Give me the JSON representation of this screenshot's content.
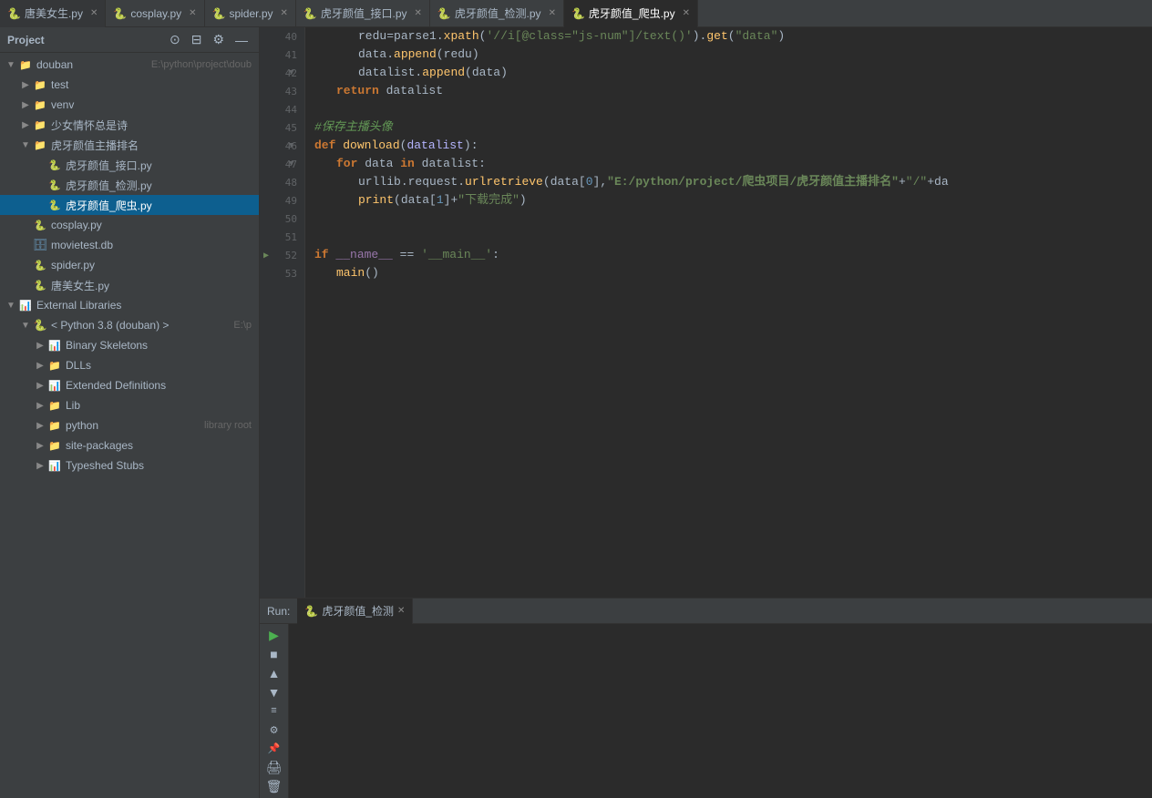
{
  "project": {
    "title": "Project",
    "header": {
      "title": "Project"
    }
  },
  "tabs": [
    {
      "id": "tab-唐美女生",
      "label": "唐美女生.py",
      "active": false,
      "icon": "🐍"
    },
    {
      "id": "tab-cosplay",
      "label": "cosplay.py",
      "active": false,
      "icon": "🐍"
    },
    {
      "id": "tab-spider",
      "label": "spider.py",
      "active": false,
      "icon": "🐍"
    },
    {
      "id": "tab-虎牙颜值接口",
      "label": "虎牙颜值_接口.py",
      "active": false,
      "icon": "🐍"
    },
    {
      "id": "tab-虎牙颜值检测",
      "label": "虎牙颜值_检测.py",
      "active": false,
      "icon": "🐍"
    },
    {
      "id": "tab-虎牙颜值爬虫",
      "label": "虎牙颜值_爬虫.py",
      "active": true,
      "icon": "🐍"
    }
  ],
  "sidebar": {
    "title": "Project",
    "tree": [
      {
        "id": "douban",
        "label": "douban",
        "hint": "E:\\python\\project\\doub",
        "level": 0,
        "type": "folder",
        "expanded": true,
        "arrow": "▼"
      },
      {
        "id": "test",
        "label": "test",
        "hint": "",
        "level": 1,
        "type": "folder",
        "expanded": false,
        "arrow": "▶"
      },
      {
        "id": "venv",
        "label": "venv",
        "hint": "",
        "level": 1,
        "type": "folder",
        "expanded": false,
        "arrow": "▶"
      },
      {
        "id": "少女情怀总是诗",
        "label": "少女情怀总是诗",
        "hint": "",
        "level": 1,
        "type": "folder",
        "expanded": false,
        "arrow": "▶"
      },
      {
        "id": "虎牙颜值主播排名",
        "label": "虎牙颜值主播排名",
        "hint": "",
        "level": 1,
        "type": "folder",
        "expanded": true,
        "arrow": "▼"
      },
      {
        "id": "虎牙颜值接口py",
        "label": "虎牙颜值_接口.py",
        "hint": "",
        "level": 2,
        "type": "py",
        "arrow": ""
      },
      {
        "id": "虎牙颜值检测py",
        "label": "虎牙颜值_检测.py",
        "hint": "",
        "level": 2,
        "type": "py",
        "arrow": ""
      },
      {
        "id": "虎牙颜值爬虫py",
        "label": "虎牙颜值_爬虫.py",
        "hint": "",
        "level": 2,
        "type": "py",
        "selected": true,
        "arrow": ""
      },
      {
        "id": "cosplaypy",
        "label": "cosplay.py",
        "hint": "",
        "level": 1,
        "type": "py",
        "arrow": ""
      },
      {
        "id": "movietestdb",
        "label": "movietest.db",
        "hint": "",
        "level": 1,
        "type": "db",
        "arrow": ""
      },
      {
        "id": "spiderpy",
        "label": "spider.py",
        "hint": "",
        "level": 1,
        "type": "py",
        "arrow": ""
      },
      {
        "id": "唐美女生py",
        "label": "唐美女生.py",
        "hint": "",
        "level": 1,
        "type": "py",
        "arrow": ""
      },
      {
        "id": "external-libraries",
        "label": "External Libraries",
        "hint": "",
        "level": 0,
        "type": "ext-lib",
        "expanded": true,
        "arrow": "▼"
      },
      {
        "id": "python38",
        "label": "< Python 3.8 (douban) >",
        "hint": "E:\\p",
        "level": 1,
        "type": "python",
        "expanded": true,
        "arrow": "▼"
      },
      {
        "id": "binary-skeletons",
        "label": "Binary Skeletons",
        "hint": "",
        "level": 2,
        "type": "binary",
        "expanded": false,
        "arrow": "▶"
      },
      {
        "id": "dlls",
        "label": "DLLs",
        "hint": "",
        "level": 2,
        "type": "folder",
        "expanded": false,
        "arrow": "▶"
      },
      {
        "id": "extended-definitions",
        "label": "Extended Definitions",
        "hint": "",
        "level": 2,
        "type": "binary",
        "expanded": false,
        "arrow": "▶"
      },
      {
        "id": "lib",
        "label": "Lib",
        "hint": "",
        "level": 2,
        "type": "folder",
        "expanded": false,
        "arrow": "▶"
      },
      {
        "id": "python",
        "label": "python",
        "hint": "library root",
        "level": 2,
        "type": "folder",
        "expanded": false,
        "arrow": "▶"
      },
      {
        "id": "site-packages",
        "label": "site-packages",
        "hint": "",
        "level": 2,
        "type": "folder",
        "expanded": false,
        "arrow": "▶"
      },
      {
        "id": "typeshed-stubs",
        "label": "Typeshed Stubs",
        "hint": "",
        "level": 2,
        "type": "binary",
        "expanded": false,
        "arrow": "▶"
      }
    ]
  },
  "editor": {
    "lines": [
      {
        "num": 40,
        "content": "redu=parse1.xpath('//i[@class=\"js-num\"]/text()').get(\"data\")",
        "type": "code"
      },
      {
        "num": 41,
        "content": "data.append(redu)",
        "type": "code"
      },
      {
        "num": 42,
        "content": "datalist.append(data)",
        "type": "code"
      },
      {
        "num": 43,
        "content": "return datalist",
        "type": "code"
      },
      {
        "num": 44,
        "content": "",
        "type": "empty"
      },
      {
        "num": 45,
        "content": "#保存主播头像",
        "type": "comment"
      },
      {
        "num": 46,
        "content": "def download(datalist):",
        "type": "code",
        "hasFold": true
      },
      {
        "num": 47,
        "content": "for data in datalist:",
        "type": "code",
        "hasFold": true
      },
      {
        "num": 48,
        "content": "urllib.request.urlretrieve(data[0],\"E:/python/project/爬虫项目/虎牙颜值主播排名\"+\"/\"+da",
        "type": "code"
      },
      {
        "num": 49,
        "content": "print(data[1]+\"下载完成\")",
        "type": "code"
      },
      {
        "num": 50,
        "content": "",
        "type": "empty"
      },
      {
        "num": 51,
        "content": "",
        "type": "empty"
      },
      {
        "num": 52,
        "content": "if __name__ == '__main__':",
        "type": "code",
        "hasRunMarker": true
      },
      {
        "num": 53,
        "content": "main()",
        "type": "code"
      }
    ]
  },
  "run": {
    "label": "Run:",
    "tab_label": "虎牙颜值_检测",
    "tab_icon": "🐍"
  }
}
